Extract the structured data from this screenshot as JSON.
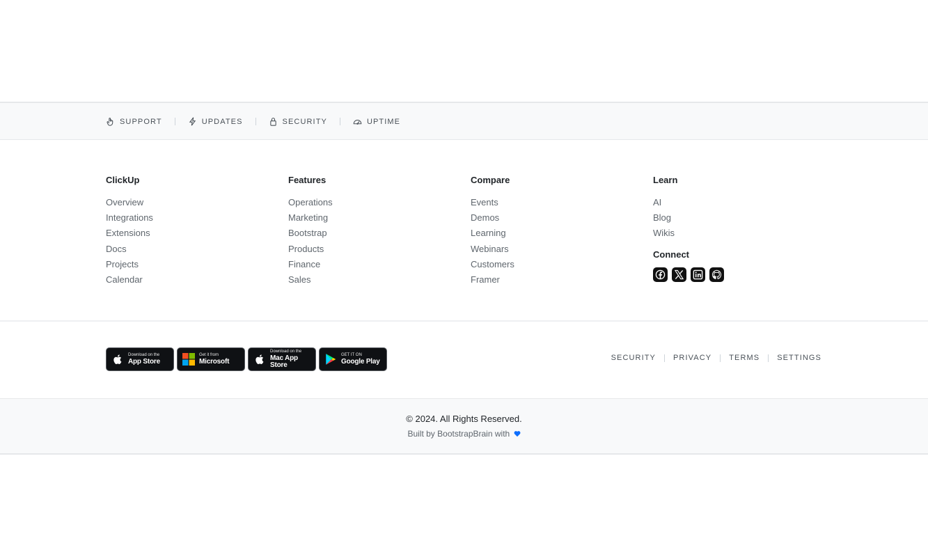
{
  "topnav": {
    "items": [
      {
        "label": "SUPPORT",
        "icon": "hand-icon"
      },
      {
        "label": "UPDATES",
        "icon": "lightning-icon"
      },
      {
        "label": "SECURITY",
        "icon": "lock-icon"
      },
      {
        "label": "UPTIME",
        "icon": "speedometer-icon"
      }
    ]
  },
  "columns": {
    "clickup": {
      "title": "ClickUp",
      "links": [
        "Overview",
        "Integrations",
        "Extensions",
        "Docs",
        "Projects",
        "Calendar"
      ]
    },
    "features": {
      "title": "Features",
      "links": [
        "Operations",
        "Marketing",
        "Bootstrap",
        "Products",
        "Finance",
        "Sales"
      ]
    },
    "compare": {
      "title": "Compare",
      "links": [
        "Events",
        "Demos",
        "Learning",
        "Webinars",
        "Customers",
        "Framer"
      ]
    },
    "learn": {
      "title": "Learn",
      "links": [
        "AI",
        "Blog",
        "Wikis"
      ]
    }
  },
  "connect": {
    "title": "Connect",
    "icons": [
      "facebook-icon",
      "x-icon",
      "linkedin-icon",
      "github-icon"
    ]
  },
  "badges": [
    {
      "small": "Download on the",
      "big": "App Store",
      "icon": "apple-icon"
    },
    {
      "small": "Get it from",
      "big": "Microsoft",
      "icon": "microsoft-icon"
    },
    {
      "small": "Download on the",
      "big": "Mac App Store",
      "icon": "apple-icon"
    },
    {
      "small": "GET IT ON",
      "big": "Google Play",
      "icon": "google-play-icon"
    }
  ],
  "legal": [
    "SECURITY",
    "PRIVACY",
    "TERMS",
    "SETTINGS"
  ],
  "footer": {
    "copyright": "© 2024. All Rights Reserved.",
    "built_prefix": "Built by",
    "built_link": "BootstrapBrain",
    "built_suffix": "with",
    "heart_color": "#0d6efd"
  }
}
